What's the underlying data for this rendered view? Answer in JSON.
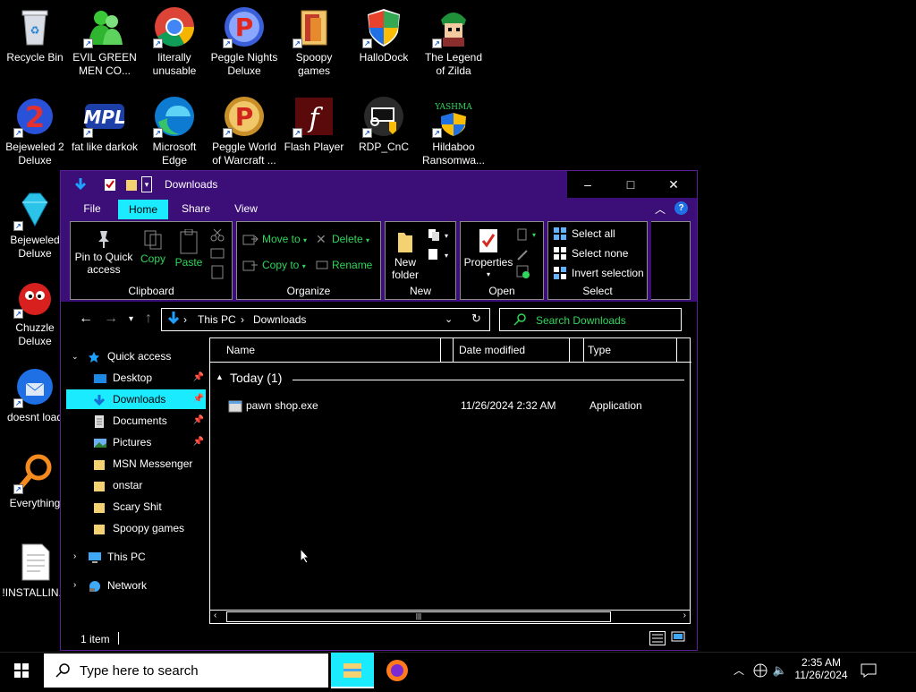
{
  "desktop_icons": [
    {
      "id": "recycle-bin",
      "label": [
        "Recycle Bin"
      ]
    },
    {
      "id": "evil-green",
      "label": [
        "EVIL GREEN",
        "MEN CO..."
      ]
    },
    {
      "id": "literally-unusable",
      "label": [
        "literally",
        "unusable"
      ]
    },
    {
      "id": "peggle-nights",
      "label": [
        "Peggle Nights",
        "Deluxe"
      ]
    },
    {
      "id": "spoopy-games",
      "label": [
        "Spoopy",
        "games"
      ]
    },
    {
      "id": "hallodock",
      "label": [
        "HalloDock"
      ]
    },
    {
      "id": "legend-zilda",
      "label": [
        "The Legend",
        "of Zilda"
      ]
    },
    {
      "id": "bejeweled2",
      "label": [
        "Bejeweled 2",
        "Deluxe"
      ]
    },
    {
      "id": "fat-darkok",
      "label": [
        "fat like darkok"
      ]
    },
    {
      "id": "edge",
      "label": [
        "Microsoft",
        "Edge"
      ]
    },
    {
      "id": "peggle-warcraft",
      "label": [
        "Peggle World",
        "of Warcraft ..."
      ]
    },
    {
      "id": "flash",
      "label": [
        "Flash Player"
      ]
    },
    {
      "id": "rdp",
      "label": [
        "RDP_CnC"
      ]
    },
    {
      "id": "hildaboo",
      "label": [
        "Hildaboo",
        "Ransomwa..."
      ]
    },
    {
      "id": "bejeweled",
      "label": [
        "Bejeweled",
        "Deluxe"
      ]
    },
    {
      "id": "chuzzle",
      "label": [
        "Chuzzle",
        "Deluxe"
      ]
    },
    {
      "id": "doesnt-load",
      "label": [
        "doesnt load"
      ]
    },
    {
      "id": "everything",
      "label": [
        "Everything"
      ]
    },
    {
      "id": "installin",
      "label": [
        "!INSTALLIN..."
      ]
    }
  ],
  "hildaboo_logo_text": "YASHMA",
  "window": {
    "title": "Downloads",
    "minimize": "–",
    "maximize": "□",
    "close": "✕",
    "tabs": [
      "File",
      "Home",
      "Share",
      "View"
    ],
    "active_tab": "Home",
    "ribbon": {
      "clipboard": {
        "name": "Clipboard",
        "pin": "Pin to Quick access",
        "copy": "Copy",
        "paste": "Paste"
      },
      "organize": {
        "name": "Organize",
        "move_to": "Move to",
        "copy_to": "Copy to",
        "delete": "Delete",
        "rename": "Rename"
      },
      "new": {
        "name": "New",
        "new_folder": "New folder"
      },
      "open": {
        "name": "Open",
        "properties": "Properties"
      },
      "select": {
        "name": "Select",
        "select_all": "Select all",
        "select_none": "Select none",
        "invert": "Invert selection"
      }
    },
    "address": {
      "crumbs": [
        "This PC",
        "Downloads"
      ]
    },
    "search_placeholder": "Search Downloads",
    "nav": {
      "quick_access": "Quick access",
      "items": [
        {
          "label": "Desktop",
          "pinned": true
        },
        {
          "label": "Downloads",
          "pinned": true,
          "selected": true
        },
        {
          "label": "Documents",
          "pinned": true
        },
        {
          "label": "Pictures",
          "pinned": true
        },
        {
          "label": "MSN Messenger",
          "pinned": false
        },
        {
          "label": "onstar",
          "pinned": false
        },
        {
          "label": "Scary Shit",
          "pinned": false
        },
        {
          "label": "Spoopy games",
          "pinned": false
        }
      ],
      "this_pc": "This PC",
      "network": "Network"
    },
    "columns": [
      "Name",
      "Date modified",
      "Type"
    ],
    "group_header": "Today (1)",
    "files": [
      {
        "name": "pawn shop.exe",
        "date": "11/26/2024 2:32 AM",
        "type": "Application"
      }
    ],
    "status": "1 item"
  },
  "taskbar": {
    "search_placeholder": "Type here to search",
    "time": "2:35 AM",
    "date": "11/26/2024"
  },
  "colors": {
    "accent": "#3c0e78",
    "highlight": "#1aebff",
    "green_text": "#2fd65a"
  }
}
